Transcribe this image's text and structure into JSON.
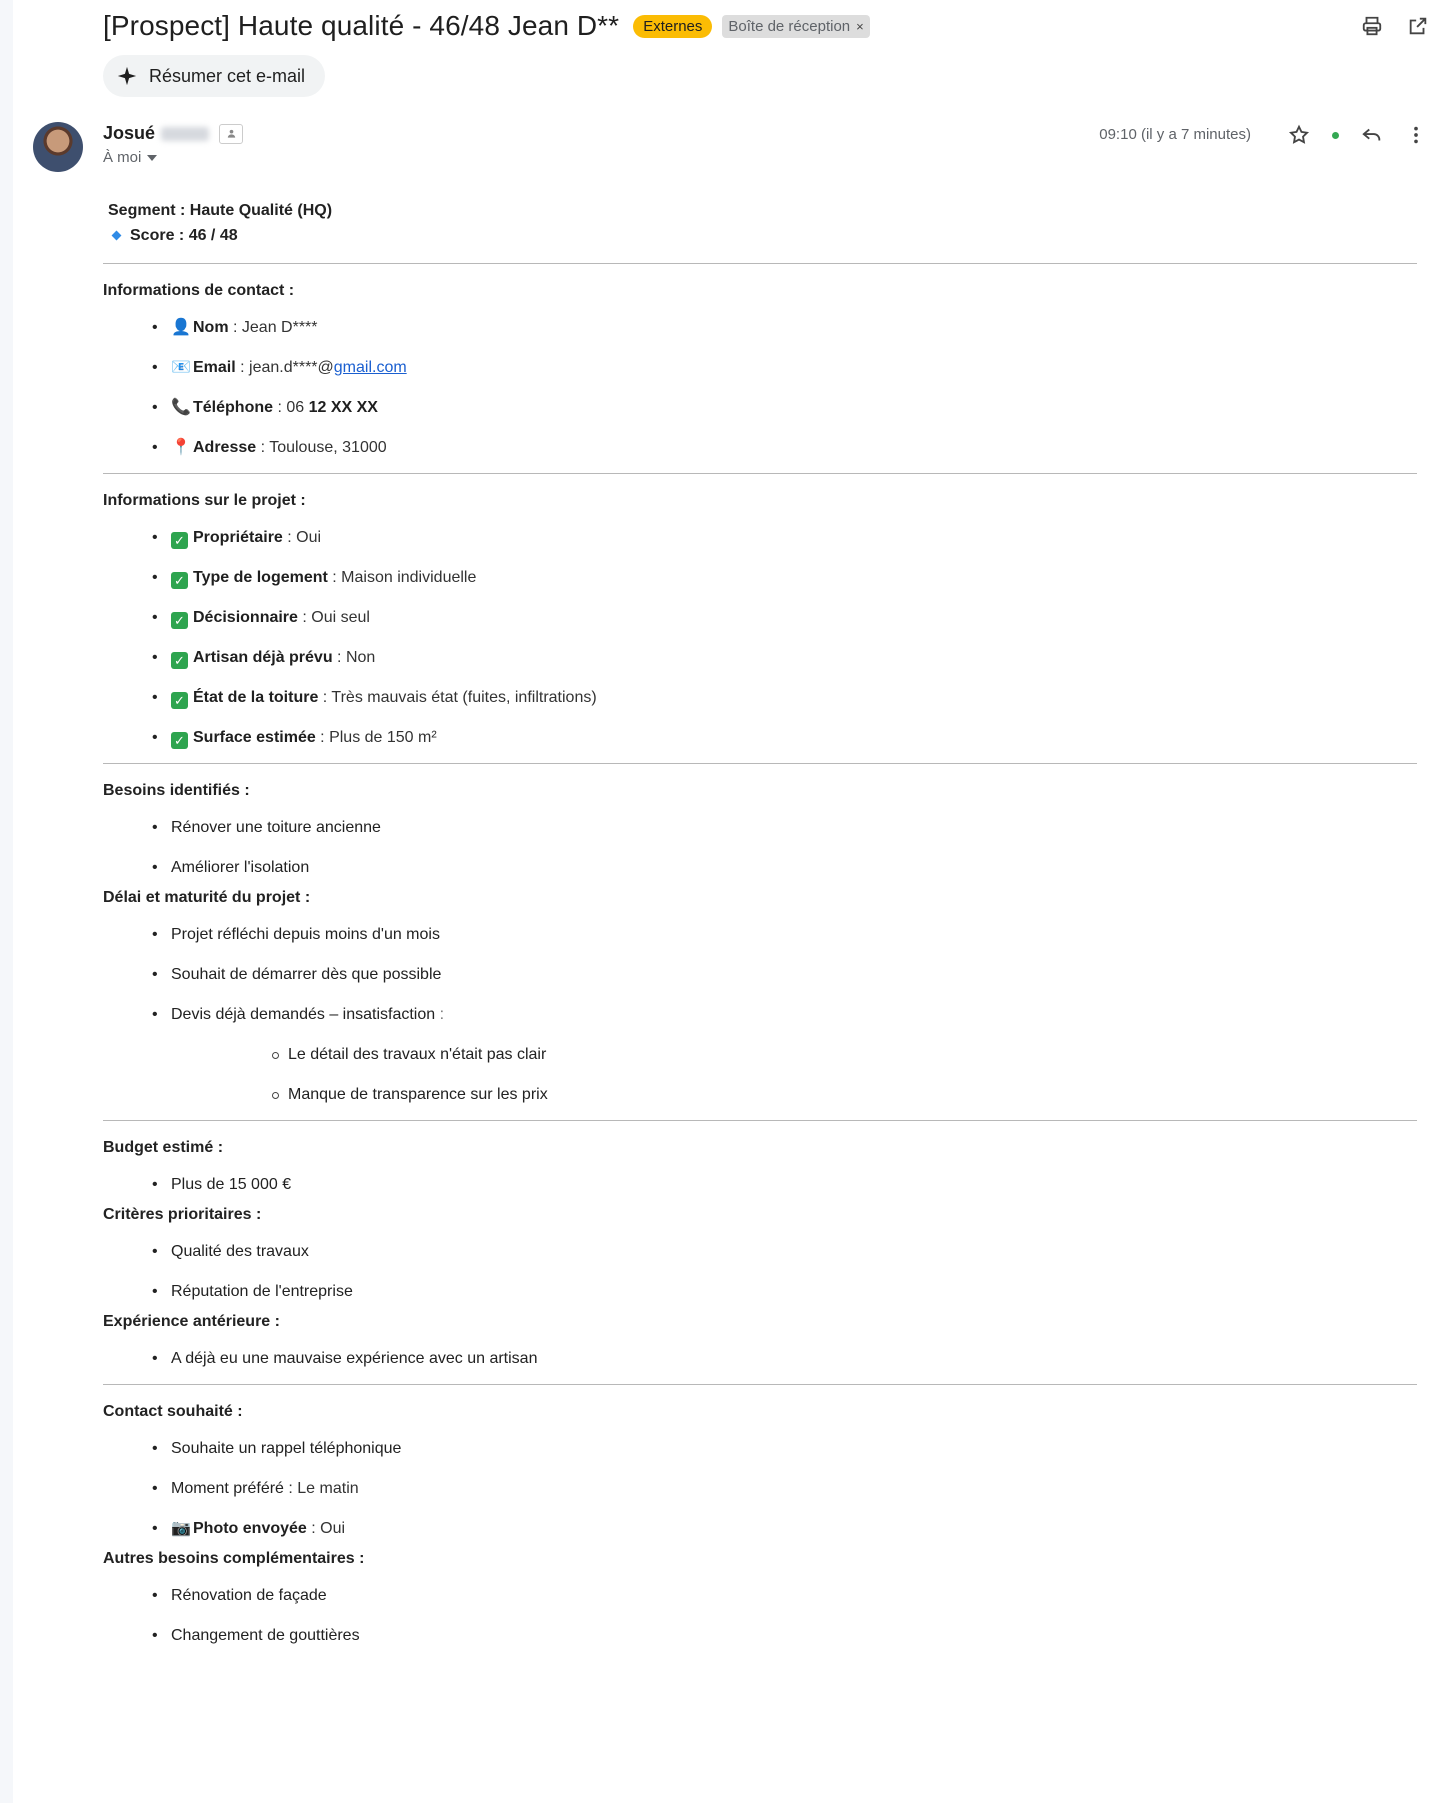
{
  "email": {
    "subject": "[Prospect] Haute qualité - 46/48 Jean D**",
    "label_external": "Externes",
    "label_inbox": "Boîte de réception",
    "label_inbox_close": "×",
    "summarize_label": "Résumer cet e-mail",
    "sender_first_name": "Josué",
    "recipient": "À moi",
    "time": "09:10 (il y a 7 minutes)"
  },
  "body": {
    "segment": "Segment : Haute Qualité (HQ)",
    "score": "Score : 46 / 48",
    "contact": {
      "heading": "Informations de contact :",
      "items": [
        {
          "icon": "👤",
          "key": "Nom",
          "val": " : Jean D****"
        },
        {
          "icon": "📧",
          "key": "Email",
          "val": " : jean.d****@",
          "link": "gmail.com"
        },
        {
          "icon": "📞",
          "key": "Téléphone",
          "val": " : 06 ",
          "val_bold": "12 XX XX"
        },
        {
          "icon": "📍",
          "key": "Adresse",
          "val": " : Toulouse, 31000"
        }
      ]
    },
    "project": {
      "heading": "Informations sur le projet :",
      "items": [
        {
          "key": "Propriétaire",
          "val": " : Oui"
        },
        {
          "key": "Type de logement",
          "val": " : Maison individuelle"
        },
        {
          "key": "Décisionnaire",
          "val": " : Oui seul"
        },
        {
          "key": "Artisan déjà prévu",
          "val": " : Non"
        },
        {
          "key": "État de la toiture",
          "val": " : Très mauvais état (fuites, infiltrations)"
        },
        {
          "key": "Surface estimée",
          "val": " : Plus de 150 m²"
        }
      ]
    },
    "needs": {
      "heading": "Besoins identifiés :",
      "items": [
        "Rénover une toiture ancienne",
        "Améliorer l'isolation"
      ]
    },
    "timing": {
      "heading": "Délai et maturité du projet :",
      "items": [
        "Projet réfléchi depuis moins d'un mois",
        "Souhait de démarrer dès que possible",
        "Devis déjà demandés – insatisfaction",
        " :"
      ],
      "subitems": [
        "Le détail des travaux n'était pas clair",
        "Manque de transparence sur les prix"
      ]
    },
    "budget": {
      "heading": "Budget estimé :",
      "items": [
        "Plus de 15 000 €"
      ]
    },
    "criteria": {
      "heading": "Critères prioritaires :",
      "items": [
        "Qualité des travaux",
        "Réputation de l'entreprise"
      ]
    },
    "experience": {
      "heading": "Expérience antérieure :",
      "items": [
        "A déjà eu une mauvaise expérience avec un artisan"
      ]
    },
    "contact_wish": {
      "heading": "Contact souhaité :",
      "items": [
        "Souhaite un rappel téléphonique",
        "Moment préféré",
        " : Le matin"
      ],
      "photo_icon": "📷",
      "photo_key": "Photo envoyée",
      "photo_val": " : Oui"
    },
    "other": {
      "heading": "Autres besoins complémentaires :",
      "items": [
        "Rénovation de façade",
        "Changement de gouttières"
      ]
    }
  },
  "icons": [
    "print-icon",
    "open-new-window-icon",
    "sparkle-icon",
    "star-icon",
    "reply-icon",
    "more-vert-icon",
    "chevron-down-icon"
  ],
  "colors": {
    "external_label": "#fbbc04",
    "link": "#1a5fd0",
    "check": "#2ea44f"
  }
}
